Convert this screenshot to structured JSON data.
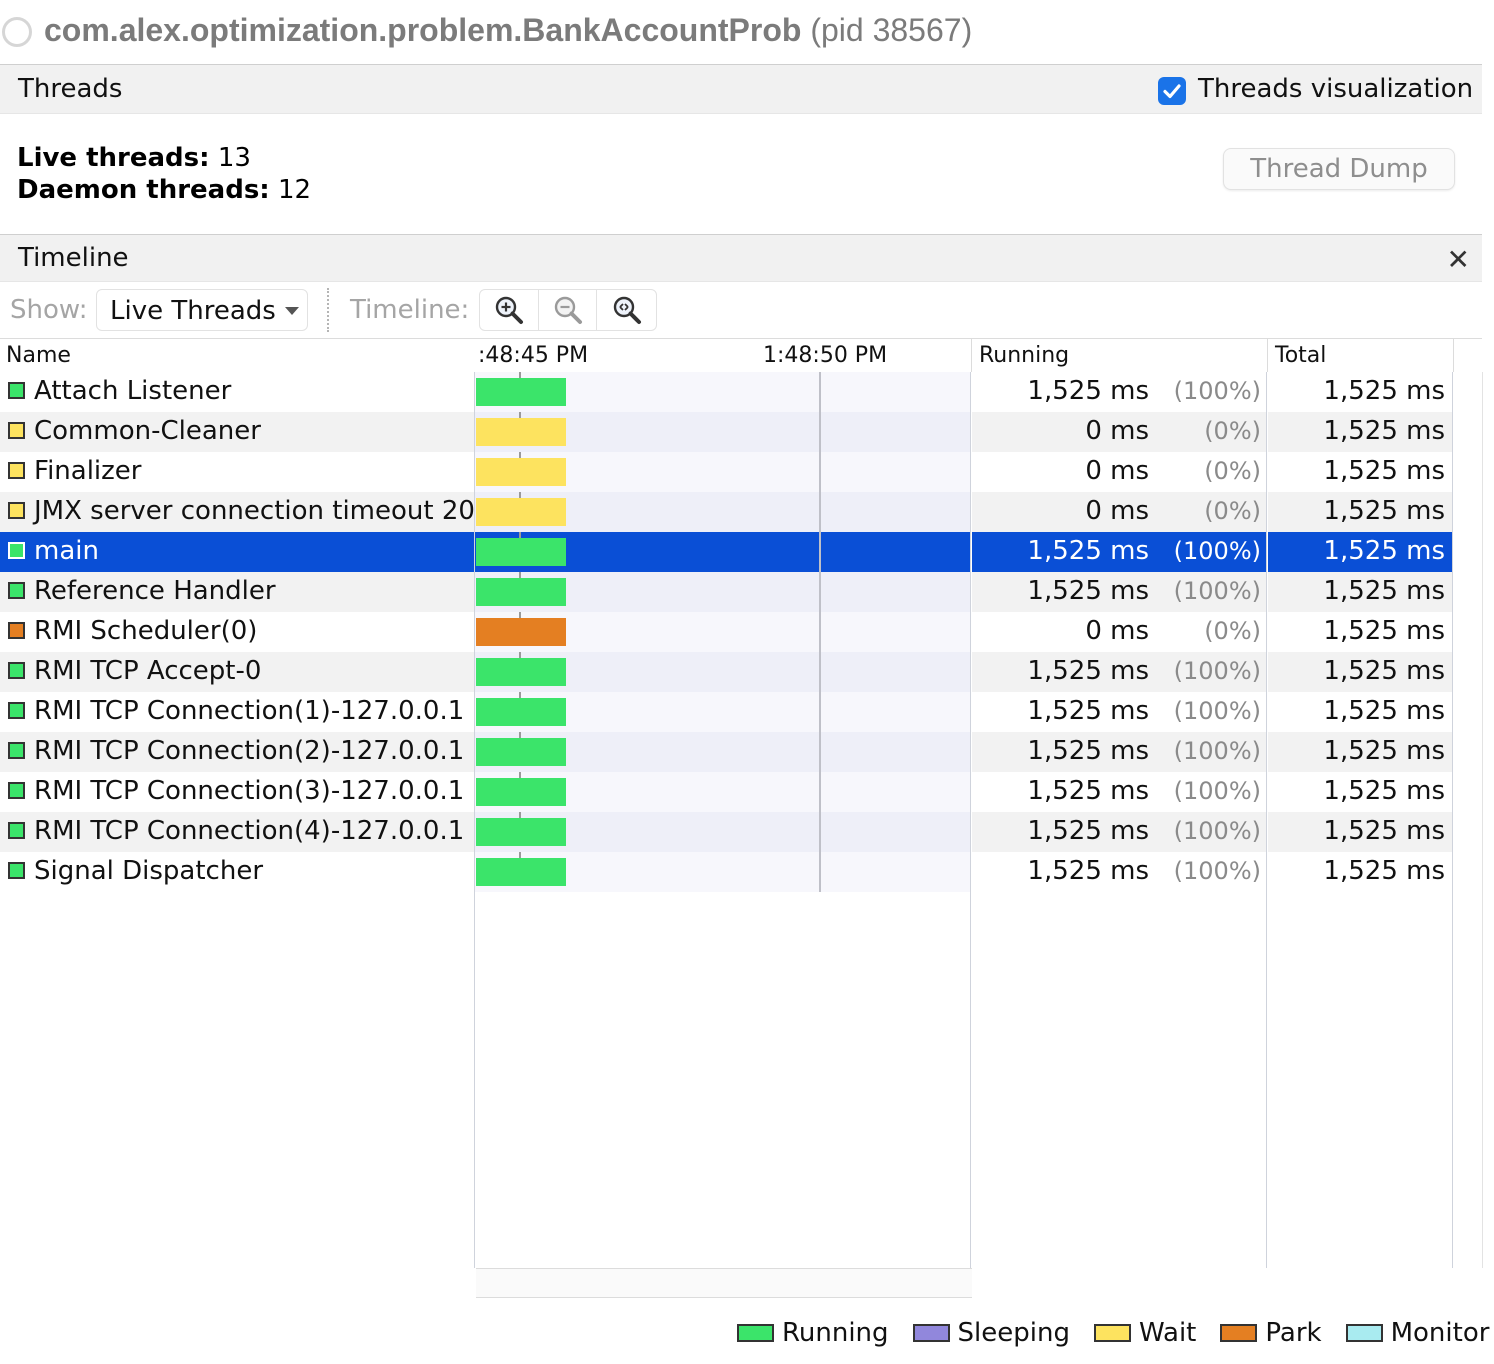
{
  "window": {
    "title": "com.alex.optimization.problem.BankAccountProb",
    "pid": "(pid 38567)"
  },
  "threads_section": {
    "title": "Threads",
    "visualization_label": "Threads visualization",
    "visualization_checked": true,
    "live_threads_label": "Live threads:",
    "live_threads_value": "13",
    "daemon_threads_label": "Daemon threads:",
    "daemon_threads_value": "12",
    "thread_dump_label": "Thread Dump"
  },
  "timeline_section": {
    "title": "Timeline",
    "close_glyph": "✕",
    "show_label": "Show:",
    "show_value": "Live Threads",
    "timeline_label": "Timeline:",
    "zoom_buttons": [
      "zoom-in-icon",
      "zoom-out-icon",
      "zoom-fit-icon"
    ]
  },
  "table": {
    "headers": {
      "name": "Name",
      "time_start": ":48:45 PM",
      "time_mid": "1:48:50 PM",
      "running": "Running",
      "total": "Total"
    },
    "rows": [
      {
        "name": "Attach Listener",
        "state": "running",
        "running": "1,525 ms",
        "percent": "(100%)",
        "total": "1,525 ms"
      },
      {
        "name": "Common-Cleaner",
        "state": "wait",
        "running": "0 ms",
        "percent": "(0%)",
        "total": "1,525 ms"
      },
      {
        "name": "Finalizer",
        "state": "wait",
        "running": "0 ms",
        "percent": "(0%)",
        "total": "1,525 ms"
      },
      {
        "name": "JMX server connection timeout 20",
        "state": "wait",
        "running": "0 ms",
        "percent": "(0%)",
        "total": "1,525 ms"
      },
      {
        "name": "main",
        "state": "running",
        "running": "1,525 ms",
        "percent": "(100%)",
        "total": "1,525 ms",
        "selected": true
      },
      {
        "name": "Reference Handler",
        "state": "running",
        "running": "1,525 ms",
        "percent": "(100%)",
        "total": "1,525 ms"
      },
      {
        "name": "RMI Scheduler(0)",
        "state": "park",
        "running": "0 ms",
        "percent": "(0%)",
        "total": "1,525 ms"
      },
      {
        "name": "RMI TCP Accept-0",
        "state": "running",
        "running": "1,525 ms",
        "percent": "(100%)",
        "total": "1,525 ms"
      },
      {
        "name": "RMI TCP Connection(1)-127.0.0.1",
        "state": "running",
        "running": "1,525 ms",
        "percent": "(100%)",
        "total": "1,525 ms"
      },
      {
        "name": "RMI TCP Connection(2)-127.0.0.1",
        "state": "running",
        "running": "1,525 ms",
        "percent": "(100%)",
        "total": "1,525 ms"
      },
      {
        "name": "RMI TCP Connection(3)-127.0.0.1",
        "state": "running",
        "running": "1,525 ms",
        "percent": "(100%)",
        "total": "1,525 ms"
      },
      {
        "name": "RMI TCP Connection(4)-127.0.0.1",
        "state": "running",
        "running": "1,525 ms",
        "percent": "(100%)",
        "total": "1,525 ms"
      },
      {
        "name": "Signal Dispatcher",
        "state": "running",
        "running": "1,525 ms",
        "percent": "(100%)",
        "total": "1,525 ms"
      }
    ]
  },
  "legend": [
    {
      "label": "Running",
      "state": "running"
    },
    {
      "label": "Sleeping",
      "state": "sleeping"
    },
    {
      "label": "Wait",
      "state": "wait"
    },
    {
      "label": "Park",
      "state": "park"
    },
    {
      "label": "Monitor",
      "state": "monitor"
    }
  ],
  "colors": {
    "running": "#3be46a",
    "sleeping": "#9187dc",
    "wait": "#fde35f",
    "park": "#e47f22",
    "monitor": "#a9ebf0",
    "selection": "#0a4fd6",
    "checkbox": "#1a73e8"
  }
}
